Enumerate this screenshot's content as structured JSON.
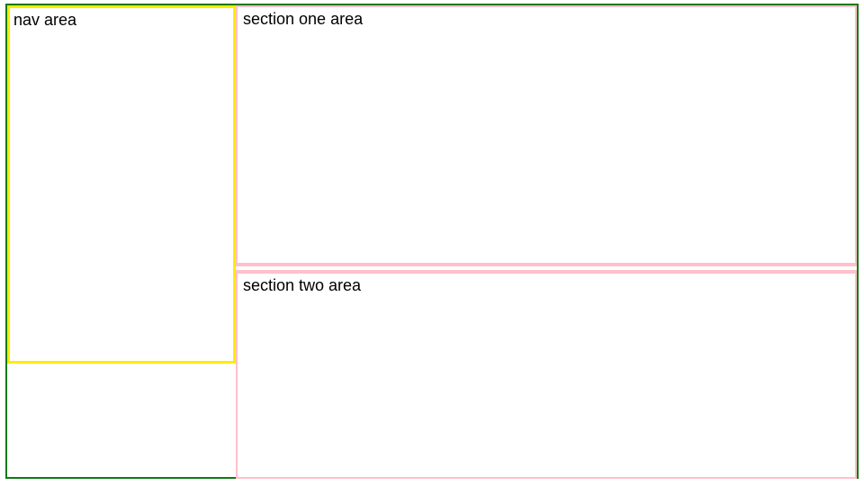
{
  "layout": {
    "nav_label": "nav area",
    "section_one_label": "section one area",
    "section_two_label": "section two area"
  },
  "colors": {
    "container_border": "#0e7a0e",
    "nav_border": "#ffeb00",
    "section_border": "#ffc0cb"
  }
}
